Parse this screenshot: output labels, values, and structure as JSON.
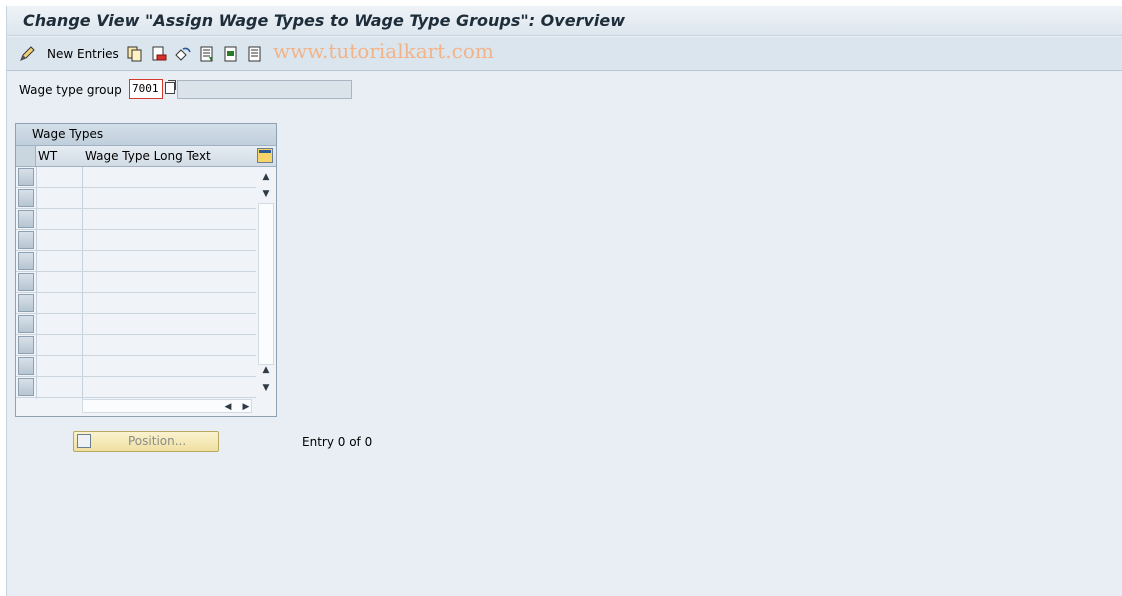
{
  "window": {
    "title": "Change View \"Assign Wage Types to Wage Type Groups\": Overview"
  },
  "toolbar": {
    "new_entries_label": "New Entries",
    "icons": [
      "change-display-icon",
      "copy-icon",
      "delete-icon",
      "undo-change-icon",
      "select-all-icon",
      "select-block-icon",
      "deselect-all-icon"
    ],
    "watermark": "www.tutorialkart.com"
  },
  "form": {
    "wage_type_group_label": "Wage type group",
    "wage_type_group_value": "7001",
    "wage_type_group_description": ""
  },
  "table": {
    "title": "Wage Types",
    "columns": [
      "WT",
      "Wage Type Long Text"
    ],
    "rows": [
      [
        "",
        ""
      ],
      [
        "",
        ""
      ],
      [
        "",
        ""
      ],
      [
        "",
        ""
      ],
      [
        "",
        ""
      ],
      [
        "",
        ""
      ],
      [
        "",
        ""
      ],
      [
        "",
        ""
      ],
      [
        "",
        ""
      ],
      [
        "",
        ""
      ],
      [
        "",
        ""
      ]
    ]
  },
  "footer": {
    "position_button_label": "Position...",
    "entry_status": "Entry 0 of 0"
  },
  "colors": {
    "background": "#e8eef4",
    "title_text": "#1e2d3a",
    "required_field_border": "#d53a2c",
    "position_button": "#f3e6ad",
    "watermark": "#f2b38a"
  }
}
